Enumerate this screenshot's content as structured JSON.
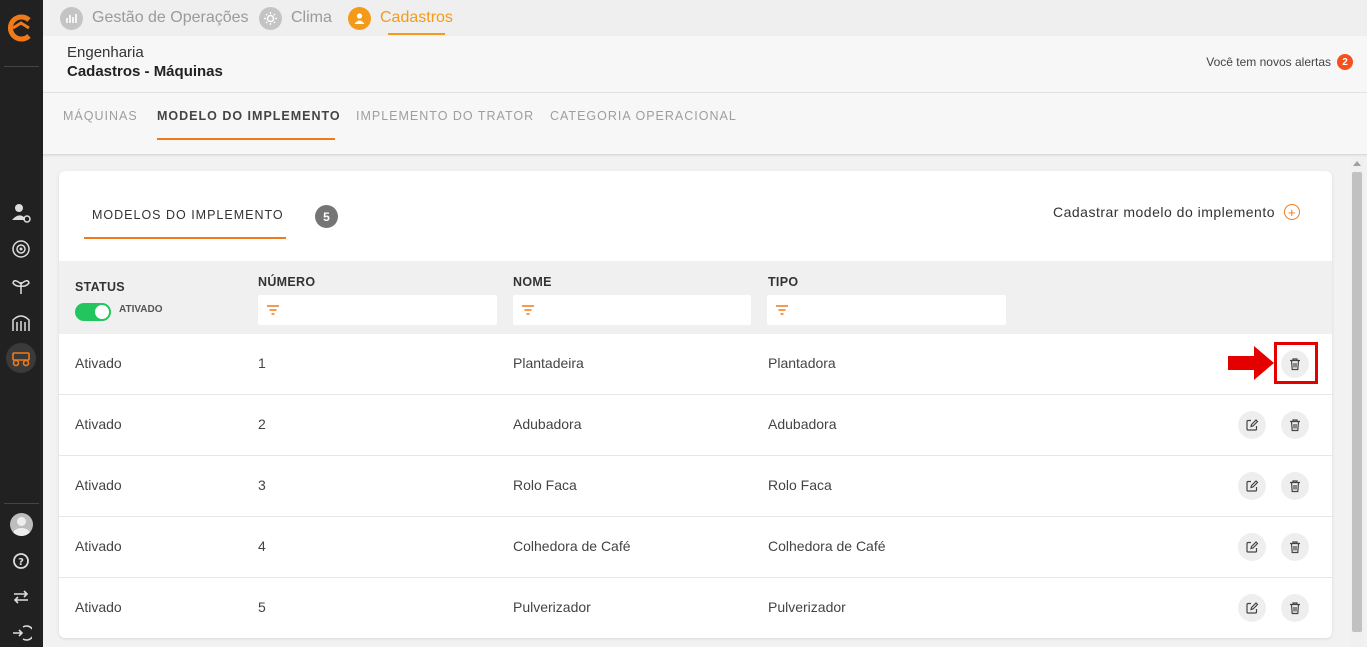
{
  "topnav": {
    "items": [
      {
        "label": "Gestão de Operações",
        "icon": "chart-icon"
      },
      {
        "label": "Clima",
        "icon": "sun-icon"
      },
      {
        "label": "Cadastros",
        "icon": "user-icon"
      }
    ],
    "active_index": 2,
    "accent": "#f49a1b"
  },
  "header": {
    "breadcrumb_top": "Engenharia",
    "title": "Cadastros - Máquinas",
    "alerts_text": "Você tem novos alertas",
    "alerts_count": "2"
  },
  "subtabs": [
    {
      "label": "Máquinas"
    },
    {
      "label": "Modelo do implemento"
    },
    {
      "label": "Implemento do trator"
    },
    {
      "label": "Categoria operacional"
    }
  ],
  "card": {
    "tab_label": "MODELOS DO IMPLEMENTO",
    "count": "5",
    "add_label": "Cadastrar modelo do implemento"
  },
  "table": {
    "headers": {
      "status": "STATUS",
      "numero": "NÚMERO",
      "nome": "NOME",
      "tipo": "TIPO"
    },
    "status_toggle_label": "ATIVADO",
    "filters": {
      "numero": "",
      "nome": "",
      "tipo": ""
    },
    "rows": [
      {
        "status": "Ativado",
        "numero": "1",
        "nome": "Plantadeira",
        "tipo": "Plantadora"
      },
      {
        "status": "Ativado",
        "numero": "2",
        "nome": "Adubadora",
        "tipo": "Adubadora"
      },
      {
        "status": "Ativado",
        "numero": "3",
        "nome": "Rolo Faca",
        "tipo": "Rolo Faca"
      },
      {
        "status": "Ativado",
        "numero": "4",
        "nome": "Colhedora de Café",
        "tipo": "Colhedora de Café"
      },
      {
        "status": "Ativado",
        "numero": "5",
        "nome": "Pulverizador",
        "tipo": "Pulverizador"
      }
    ]
  },
  "colors": {
    "sidebar_bg": "#212121",
    "accent_orange": "#f07a1a",
    "toggle_on": "#22c55e",
    "highlight_red": "#e50000"
  }
}
